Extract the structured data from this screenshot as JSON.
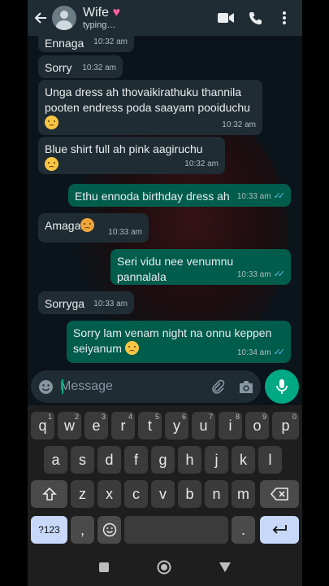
{
  "header": {
    "contact_name": "Wife",
    "status": "typing…"
  },
  "messages": [
    {
      "dir": "in",
      "text": "Ennaga",
      "time": "10:32 am"
    },
    {
      "dir": "in",
      "text": "Sorry",
      "time": "10:32 am"
    },
    {
      "dir": "in",
      "text": "Unga dress ah thovaikirathuku thannila pooten endress poda saayam pooiduchu",
      "time": "10:32 am",
      "emoji": "frowning-face"
    },
    {
      "dir": "in",
      "text": "Blue shirt full ah pink aagiruchu",
      "time": "10:32 am",
      "emoji": "sad-face"
    },
    {
      "dir": "out",
      "text": "Ethu ennoda birthday dress ah",
      "time": "10:33 am"
    },
    {
      "dir": "in",
      "text": "Amaga",
      "time": "10:33 am",
      "emoji": "angry-face"
    },
    {
      "dir": "out",
      "text": "Seri vidu nee venumnu pannalala",
      "time": "10:33 am"
    },
    {
      "dir": "in",
      "text": "Sorryga",
      "time": "10:33 am"
    },
    {
      "dir": "out",
      "text": "Sorry lam venam night na onnu keppen seiyanum",
      "time": "10:34 am",
      "emoji": "relieved-face"
    }
  ],
  "composer": {
    "placeholder": "Message"
  },
  "keyboard": {
    "row1": [
      [
        "q",
        "1"
      ],
      [
        "w",
        "2"
      ],
      [
        "e",
        "3"
      ],
      [
        "r",
        "4"
      ],
      [
        "t",
        "5"
      ],
      [
        "y",
        "6"
      ],
      [
        "u",
        "7"
      ],
      [
        "i",
        "8"
      ],
      [
        "o",
        "9"
      ],
      [
        "p",
        "0"
      ]
    ],
    "row2": [
      "a",
      "s",
      "d",
      "f",
      "g",
      "h",
      "j",
      "k",
      "l"
    ],
    "row3": [
      "z",
      "x",
      "c",
      "v",
      "b",
      "n",
      "m"
    ],
    "symbols_label": "?123",
    "comma": ",",
    "period": "."
  },
  "colors": {
    "incoming_bubble": "#202c33",
    "outgoing_bubble": "#005c4b",
    "accent": "#00a884",
    "read_ticks": "#53bdeb"
  }
}
